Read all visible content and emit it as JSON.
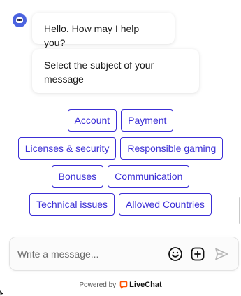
{
  "chat": {
    "messages": [
      "Hello. How may I help you?",
      "Select the subject of your message"
    ]
  },
  "quick_replies": [
    [
      "Account",
      "Payment"
    ],
    [
      "Licenses & security",
      "Responsible gaming"
    ],
    [
      "Bonuses",
      "Communication"
    ],
    [
      "Technical issues",
      "Allowed Countries"
    ]
  ],
  "composer": {
    "placeholder": "Write a message...",
    "emoji_icon": "smiley-icon",
    "attach_icon": "plus-square-icon",
    "send_icon": "send-icon"
  },
  "footer": {
    "powered_by": "Powered by",
    "brand": "LiveChat",
    "brand_color": "#ff5100"
  },
  "colors": {
    "accent": "#3c2fd6",
    "avatar": "#4b63e0"
  }
}
